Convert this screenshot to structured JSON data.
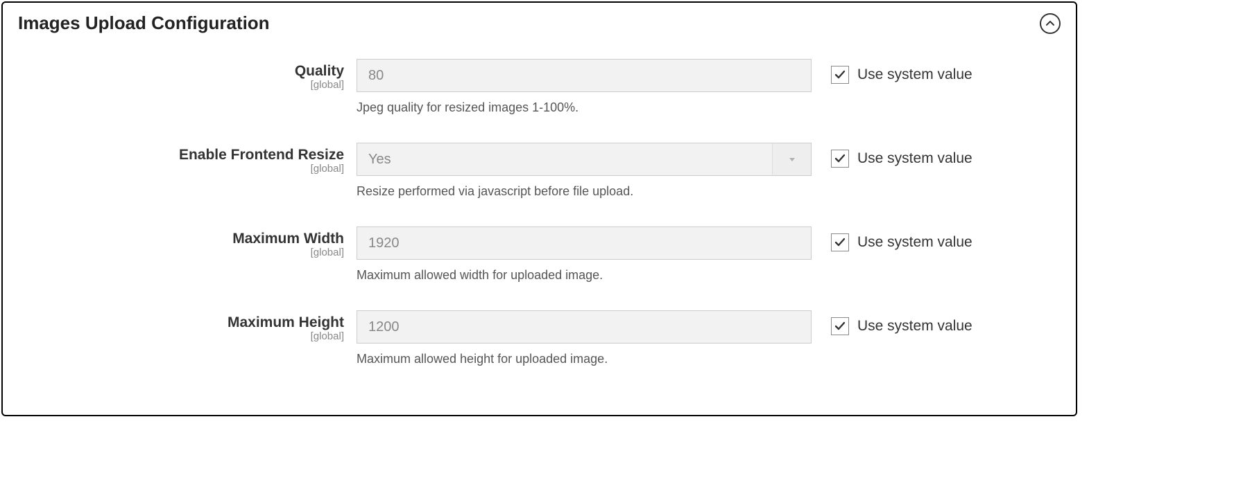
{
  "section": {
    "title": "Images Upload Configuration"
  },
  "common": {
    "scope": "[global]",
    "systemValueLabel": "Use system value"
  },
  "fields": {
    "quality": {
      "label": "Quality",
      "value": "80",
      "hint": "Jpeg quality for resized images 1-100%.",
      "useSystem": true
    },
    "frontendResize": {
      "label": "Enable Frontend Resize",
      "value": "Yes",
      "hint": "Resize performed via javascript before file upload.",
      "useSystem": true
    },
    "maxWidth": {
      "label": "Maximum Width",
      "value": "1920",
      "hint": "Maximum allowed width for uploaded image.",
      "useSystem": true
    },
    "maxHeight": {
      "label": "Maximum Height",
      "value": "1200",
      "hint": "Maximum allowed height for uploaded image.",
      "useSystem": true
    }
  }
}
